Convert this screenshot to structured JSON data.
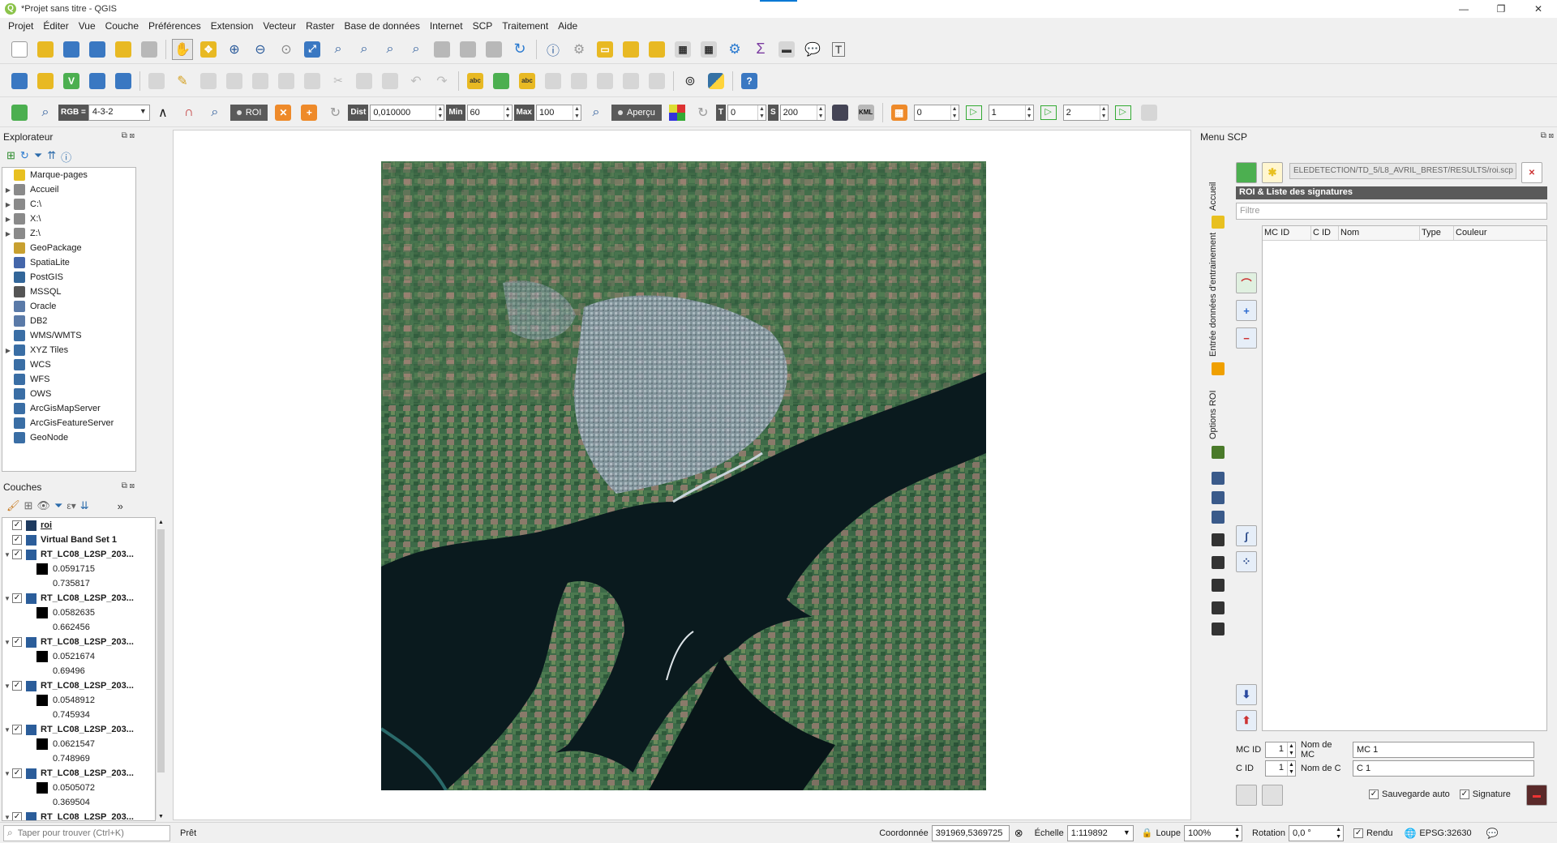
{
  "window": {
    "title": "*Projet sans titre - QGIS",
    "buttons": [
      "—",
      "❐",
      "✕"
    ]
  },
  "menu": [
    "Projet",
    "Éditer",
    "Vue",
    "Couche",
    "Préférences",
    "Extension",
    "Vecteur",
    "Raster",
    "Base de données",
    "Internet",
    "SCP",
    "Traitement",
    "Aide"
  ],
  "scp_toolbar": {
    "rgb_label": "RGB =",
    "rgb_value": "4-3-2",
    "roi_label": "ROI",
    "dist_label": "Dist",
    "dist_value": "0,010000",
    "min_label": "Min",
    "min_value": "60",
    "max_label": "Max",
    "max_value": "100",
    "apercu_label": "Aperçu",
    "t_label": "T",
    "t_value": "0",
    "s_label": "S",
    "s_value": "200",
    "kml_label": "KML",
    "band_value_1": "0",
    "band_value_2": "1",
    "band_value_3": "2"
  },
  "explorer": {
    "title": "Explorateur",
    "items": [
      {
        "label": "Marque-pages",
        "icon": "star-icon",
        "expandable": false,
        "color": "#e8c020"
      },
      {
        "label": "Accueil",
        "icon": "home-folder-icon",
        "expandable": true,
        "color": "#8a8a8a"
      },
      {
        "label": "C:\\",
        "icon": "drive-icon",
        "expandable": true,
        "color": "#8a8a8a"
      },
      {
        "label": "X:\\",
        "icon": "drive-icon",
        "expandable": true,
        "color": "#8a8a8a"
      },
      {
        "label": "Z:\\",
        "icon": "drive-icon",
        "expandable": true,
        "color": "#8a8a8a"
      },
      {
        "label": "GeoPackage",
        "icon": "geopackage-icon",
        "expandable": false,
        "color": "#c8a030"
      },
      {
        "label": "SpatiaLite",
        "icon": "spatialite-icon",
        "expandable": false,
        "color": "#4466aa"
      },
      {
        "label": "PostGIS",
        "icon": "postgis-icon",
        "expandable": false,
        "color": "#336699"
      },
      {
        "label": "MSSQL",
        "icon": "mssql-icon",
        "expandable": false,
        "color": "#555555"
      },
      {
        "label": "Oracle",
        "icon": "oracle-icon",
        "expandable": false,
        "color": "#5a7aa8"
      },
      {
        "label": "DB2",
        "icon": "db2-icon",
        "expandable": false,
        "color": "#5a7aa8"
      },
      {
        "label": "WMS/WMTS",
        "icon": "globe-icon",
        "expandable": false,
        "color": "#3a6ea5"
      },
      {
        "label": "XYZ Tiles",
        "icon": "globe-icon",
        "expandable": true,
        "color": "#3a6ea5"
      },
      {
        "label": "WCS",
        "icon": "globe-icon",
        "expandable": false,
        "color": "#3a6ea5"
      },
      {
        "label": "WFS",
        "icon": "globe-icon",
        "expandable": false,
        "color": "#3a6ea5"
      },
      {
        "label": "OWS",
        "icon": "globe-icon",
        "expandable": false,
        "color": "#3a6ea5"
      },
      {
        "label": "ArcGisMapServer",
        "icon": "globe-icon",
        "expandable": false,
        "color": "#3a6ea5"
      },
      {
        "label": "ArcGisFeatureServer",
        "icon": "globe-icon",
        "expandable": false,
        "color": "#3a6ea5"
      },
      {
        "label": "GeoNode",
        "icon": "geonode-icon",
        "expandable": false,
        "color": "#3a6ea5"
      }
    ]
  },
  "layers": {
    "title": "Couches",
    "rows": [
      {
        "kind": "layer",
        "name": "roi",
        "bold": true,
        "underline": true,
        "expand": "",
        "icon_color": "#1e3a5f"
      },
      {
        "kind": "layer",
        "name": "Virtual Band Set 1",
        "bold": true,
        "expand": "",
        "icon_color": "#2b5d9a"
      },
      {
        "kind": "layer",
        "name": "RT_LC08_L2SP_203...",
        "bold": true,
        "expand": "▼",
        "icon_color": "#2b5d9a"
      },
      {
        "kind": "swatch",
        "value": "0.0591715"
      },
      {
        "kind": "value",
        "value": "0.735817"
      },
      {
        "kind": "layer",
        "name": "RT_LC08_L2SP_203...",
        "bold": true,
        "expand": "▼",
        "icon_color": "#2b5d9a"
      },
      {
        "kind": "swatch",
        "value": "0.0582635"
      },
      {
        "kind": "value",
        "value": "0.662456"
      },
      {
        "kind": "layer",
        "name": "RT_LC08_L2SP_203...",
        "bold": true,
        "expand": "▼",
        "icon_color": "#2b5d9a"
      },
      {
        "kind": "swatch",
        "value": "0.0521674"
      },
      {
        "kind": "value",
        "value": "0.69496"
      },
      {
        "kind": "layer",
        "name": "RT_LC08_L2SP_203...",
        "bold": true,
        "expand": "▼",
        "icon_color": "#2b5d9a"
      },
      {
        "kind": "swatch",
        "value": "0.0548912"
      },
      {
        "kind": "value",
        "value": "0.745934"
      },
      {
        "kind": "layer",
        "name": "RT_LC08_L2SP_203...",
        "bold": true,
        "expand": "▼",
        "icon_color": "#2b5d9a"
      },
      {
        "kind": "swatch",
        "value": "0.0621547"
      },
      {
        "kind": "value",
        "value": "0.748969"
      },
      {
        "kind": "layer",
        "name": "RT_LC08_L2SP_203...",
        "bold": true,
        "expand": "▼",
        "icon_color": "#2b5d9a"
      },
      {
        "kind": "swatch",
        "value": "0.0505072"
      },
      {
        "kind": "value",
        "value": "0.369504"
      },
      {
        "kind": "layer",
        "name": "RT_LC08_L2SP_203...",
        "bold": true,
        "expand": "▼",
        "icon_color": "#2b5d9a"
      }
    ]
  },
  "scp": {
    "title": "Menu SCP",
    "tabs": [
      "Accueil",
      "Entrée données d'entrainement",
      "Options ROI"
    ],
    "path": "ELEDETECTION/TD_5/L8_AVRIL_BREST/RESULTS/roi.scp",
    "section_title": "ROI & Liste des signatures",
    "filter_placeholder": "Filtre",
    "columns": [
      "MC ID",
      "C ID",
      "Nom",
      "Type",
      "Couleur"
    ],
    "mc_id_label": "MC ID",
    "mc_id_value": "1",
    "mc_name_label": "Nom de MC",
    "mc_name_value": "MC 1",
    "c_id_label": "C ID",
    "c_id_value": "1",
    "c_name_label": "Nom de C",
    "c_name_value": "C 1",
    "autosave_label": "Sauvegarde auto",
    "signature_label": "Signature"
  },
  "status": {
    "search_placeholder": "Taper pour trouver (Ctrl+K)",
    "ready": "Prêt",
    "coord_label": "Coordonnée",
    "coord_value": "391969,5369725",
    "scale_label": "Échelle",
    "scale_value": "1:119892",
    "magnifier_label": "Loupe",
    "magnifier_value": "100%",
    "rotation_label": "Rotation",
    "rotation_value": "0,0 °",
    "render_label": "Rendu",
    "crs": "EPSG:32630"
  },
  "colors": {
    "accent": "#0078d4",
    "water": "#071418",
    "land_green": "#3f6a4a"
  }
}
